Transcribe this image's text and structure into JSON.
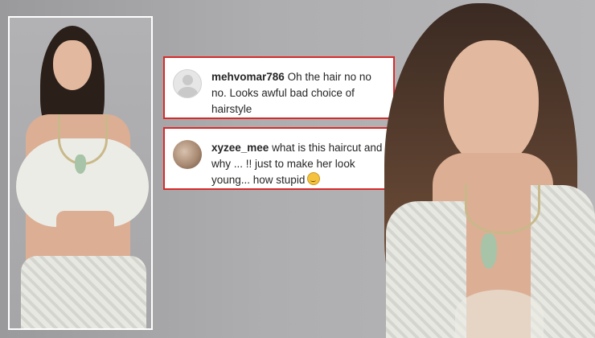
{
  "comments": [
    {
      "username": "mehvomar786",
      "text": "Oh the hair no no no. Looks awful bad choice of hairstyle",
      "avatar": "default-profile-avatar"
    },
    {
      "username": "xyzee_mee",
      "text": "what is this haircut and why ... !! just to make her look young... how stupid",
      "avatar": "user-photo-avatar",
      "emoji": "flushed-face-emoji"
    }
  ],
  "colors": {
    "highlight_border": "#d82a2a",
    "background": "#aeaeb0",
    "comment_text": "#262626"
  }
}
